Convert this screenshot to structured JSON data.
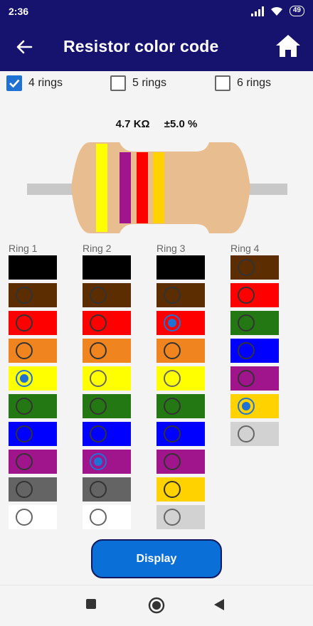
{
  "status": {
    "time": "2:36",
    "battery": "49"
  },
  "app_bar": {
    "title": "Resistor color code"
  },
  "ring_modes": [
    {
      "label": "4 rings",
      "checked": true
    },
    {
      "label": "5 rings",
      "checked": false
    },
    {
      "label": "6 rings",
      "checked": false
    }
  ],
  "result": {
    "resistance": "4.7 KΩ",
    "tolerance": "±5.0 %"
  },
  "resistor": {
    "body_color": "#e8be90",
    "lead_color": "#c8c8c8",
    "band_colors": [
      "#ffff00",
      "#a0148c",
      "#ff0000",
      "#ffd200"
    ]
  },
  "rings": [
    {
      "label": "Ring 1",
      "colors": [
        "#000000",
        "#5c2d00",
        "#ff0000",
        "#f0841e",
        "#ffff00",
        "#247814",
        "#0000ff",
        "#a0148c",
        "#646464",
        "#ffffff"
      ],
      "selected": 4
    },
    {
      "label": "Ring 2",
      "colors": [
        "#000000",
        "#5c2d00",
        "#ff0000",
        "#f0841e",
        "#ffff00",
        "#247814",
        "#0000ff",
        "#a0148c",
        "#646464",
        "#ffffff"
      ],
      "selected": 7
    },
    {
      "label": "Ring 3",
      "colors": [
        "#000000",
        "#5c2d00",
        "#ff0000",
        "#f0841e",
        "#ffff00",
        "#247814",
        "#0000ff",
        "#a0148c",
        "#ffd200",
        "#d2d2d2"
      ],
      "selected": 2
    },
    {
      "label": "Ring 4",
      "colors": [
        "#5c2d00",
        "#ff0000",
        "#247814",
        "#0000ff",
        "#a0148c",
        "#ffd200",
        "#d2d2d2"
      ],
      "selected": 5
    }
  ],
  "display_button": {
    "label": "Display"
  },
  "colors": {
    "primary": "#16136f",
    "accent": "#1f72d4",
    "button": "#0a6fd6"
  }
}
